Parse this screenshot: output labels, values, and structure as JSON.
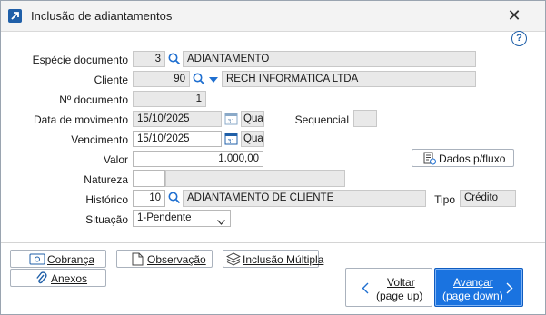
{
  "window": {
    "title": "Inclusão de adiantamentos"
  },
  "help": {
    "label": "?"
  },
  "form": {
    "especie": {
      "label": "Espécie documento",
      "code": "3",
      "name": "ADIANTAMENTO"
    },
    "cliente": {
      "label": "Cliente",
      "code": "90",
      "name": "RECH INFORMATICA LTDA"
    },
    "documento": {
      "label": "Nº documento",
      "value": "1"
    },
    "movimento": {
      "label": "Data de movimento",
      "date": "15/10/2025",
      "day": "Qua"
    },
    "sequencial": {
      "label": "Sequencial",
      "value": ""
    },
    "vencimento": {
      "label": "Vencimento",
      "date": "15/10/2025",
      "day": "Qua"
    },
    "valor": {
      "label": "Valor",
      "value": "1.000,00"
    },
    "natureza": {
      "label": "Natureza",
      "code": "",
      "name": ""
    },
    "historico": {
      "label": "Histórico",
      "code": "10",
      "name": "ADIANTAMENTO DE CLIENTE"
    },
    "tipo": {
      "label": "Tipo",
      "value": "Crédito"
    },
    "situacao": {
      "label": "Situação",
      "value": "1-Pendente"
    }
  },
  "buttons": {
    "dados_fluxo": "Dados p/fluxo",
    "cobranca": "Cobrança",
    "observacao": "Observação",
    "inclusao_multipla": "Inclusão Múltipla",
    "anexos": "Anexos",
    "voltar_line1": "Voltar",
    "voltar_line2": "(page up)",
    "avancar_line1": "Avançar",
    "avancar_line2": "(page down)"
  },
  "colors": {
    "accent": "#1a73e0",
    "title_bg": "#f3f3f3",
    "icon_blue": "#1f5fa8"
  }
}
